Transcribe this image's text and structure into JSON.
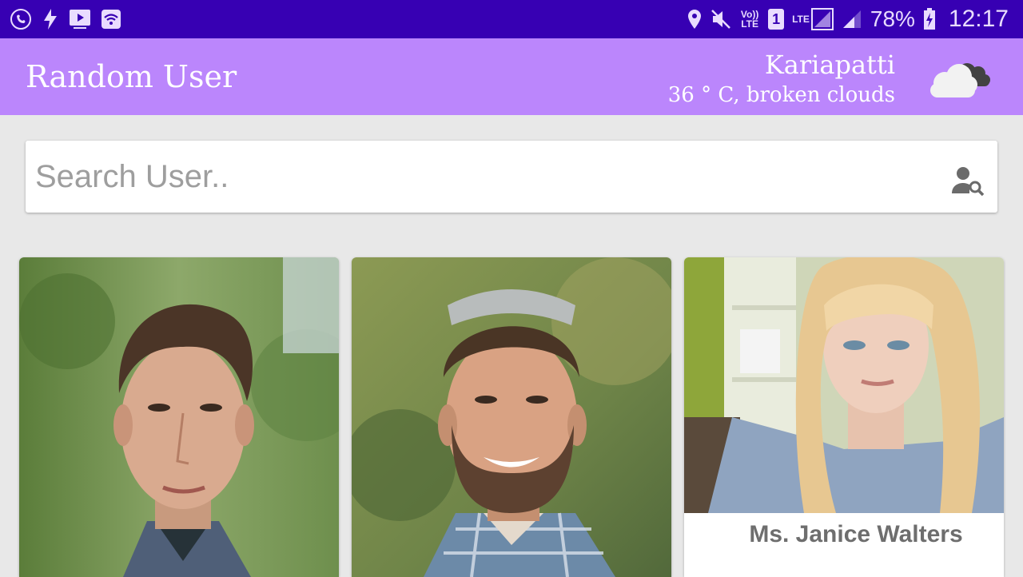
{
  "status_bar": {
    "battery": "78%",
    "time": "12:17",
    "volte_label": "Vo)) LTE",
    "sim_label": "1",
    "lte_label": "LTE",
    "icons": [
      "call-icon",
      "flash-icon",
      "media-icon",
      "wifi-icon",
      "location-icon",
      "mute-icon",
      "volte-icon",
      "sim-icon",
      "lte-signal-icon",
      "signal-icon",
      "battery-icon"
    ]
  },
  "app_bar": {
    "title": "Random User",
    "weather": {
      "city": "Kariapatti",
      "description": "36 ° C, broken clouds",
      "icon": "broken-clouds-icon"
    }
  },
  "search": {
    "placeholder": "Search User..",
    "value": "",
    "icon": "user-search-icon"
  },
  "users": [
    {
      "name": ""
    },
    {
      "name": ""
    },
    {
      "name": "Ms. Janice Walters"
    }
  ],
  "colors": {
    "status_bar": "#3700b3",
    "app_bar": "#bb86fc",
    "background": "#e8e8e8"
  }
}
